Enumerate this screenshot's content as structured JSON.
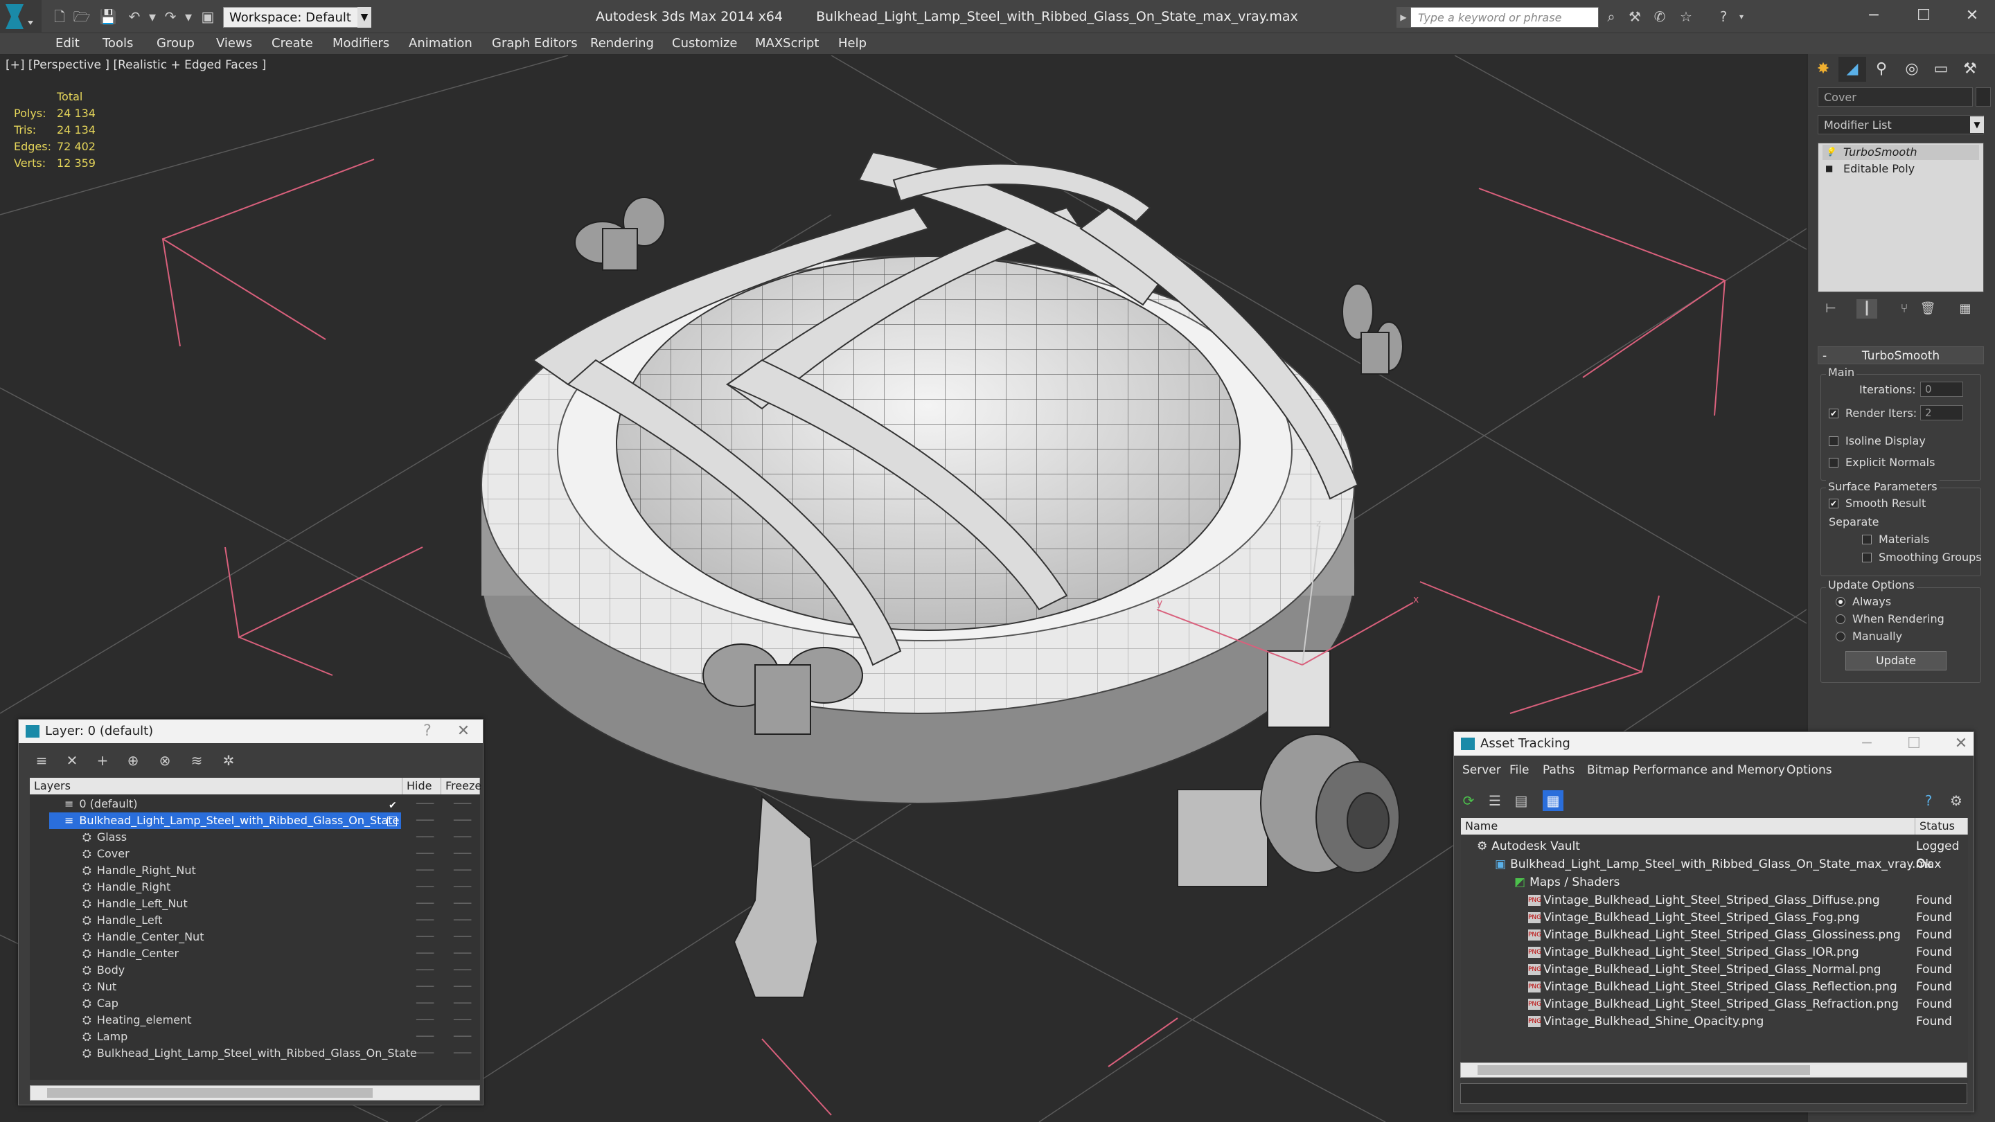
{
  "titlebar": {
    "workspace": "Workspace: Default",
    "app_name": "Autodesk 3ds Max  2014 x64",
    "file_name": "Bulkhead_Light_Lamp_Steel_with_Ribbed_Glass_On_State_max_vray.max",
    "search_placeholder": "Type a keyword or phrase"
  },
  "menu": [
    "Edit",
    "Tools",
    "Group",
    "Views",
    "Create",
    "Modifiers",
    "Animation",
    "Graph Editors",
    "Rendering",
    "Customize",
    "MAXScript",
    "Help"
  ],
  "viewport": {
    "label": "[+] [Perspective ] [Realistic + Edged Faces ]",
    "stats_header": "Total",
    "stats": [
      {
        "k": "Polys:",
        "v": "24 134"
      },
      {
        "k": "Tris:",
        "v": "24 134"
      },
      {
        "k": "Edges:",
        "v": "72 402"
      },
      {
        "k": "Verts:",
        "v": "12 359"
      }
    ],
    "axis": {
      "x": "x",
      "y": "y",
      "z": "z"
    }
  },
  "command_panel": {
    "object_name": "Cover",
    "modifier_list": "Modifier List",
    "stack": [
      "TurboSmooth",
      "Editable Poly"
    ],
    "rollout_title": "TurboSmooth",
    "main_group": "Main",
    "iterations_label": "Iterations:",
    "iterations_value": "0",
    "render_iters_label": "Render Iters:",
    "render_iters_value": "2",
    "isoline": "Isoline Display",
    "explicit_normals": "Explicit Normals",
    "surface_group": "Surface Parameters",
    "smooth_result": "Smooth Result",
    "separate": "Separate",
    "materials": "Materials",
    "smoothing_groups": "Smoothing Groups",
    "update_group": "Update Options",
    "always": "Always",
    "when_rendering": "When Rendering",
    "manually": "Manually",
    "update_button": "Update"
  },
  "layer_dialog": {
    "title": "Layer: 0 (default)",
    "help": "?",
    "col_layers": "Layers",
    "col_hide": "Hide",
    "col_freeze": "Freeze",
    "rows": [
      "0 (default)",
      "Bulkhead_Light_Lamp_Steel_with_Ribbed_Glass_On_State",
      "Glass",
      "Cover",
      "Handle_Right_Nut",
      "Handle_Right",
      "Handle_Left_Nut",
      "Handle_Left",
      "Handle_Center_Nut",
      "Handle_Center",
      "Body",
      "Nut",
      "Cap",
      "Heating_element",
      "Lamp",
      "Bulkhead_Light_Lamp_Steel_with_Ribbed_Glass_On_State"
    ]
  },
  "asset_dialog": {
    "title": "Asset Tracking",
    "menu": [
      "Server",
      "File",
      "Paths",
      "Bitmap Performance and Memory",
      "Options"
    ],
    "col_name": "Name",
    "col_status": "Status",
    "rows": [
      {
        "name": "Autodesk Vault",
        "status": "Logged O"
      },
      {
        "name": "Bulkhead_Light_Lamp_Steel_with_Ribbed_Glass_On_State_max_vray.max",
        "status": "Ok"
      },
      {
        "name": "Maps / Shaders",
        "status": ""
      },
      {
        "name": "Vintage_Bulkhead_Light_Steel_Striped_Glass_Diffuse.png",
        "status": "Found"
      },
      {
        "name": "Vintage_Bulkhead_Light_Steel_Striped_Glass_Fog.png",
        "status": "Found"
      },
      {
        "name": "Vintage_Bulkhead_Light_Steel_Striped_Glass_Glossiness.png",
        "status": "Found"
      },
      {
        "name": "Vintage_Bulkhead_Light_Steel_Striped_Glass_IOR.png",
        "status": "Found"
      },
      {
        "name": "Vintage_Bulkhead_Light_Steel_Striped_Glass_Normal.png",
        "status": "Found"
      },
      {
        "name": "Vintage_Bulkhead_Light_Steel_Striped_Glass_Reflection.png",
        "status": "Found"
      },
      {
        "name": "Vintage_Bulkhead_Light_Steel_Striped_Glass_Refraction.png",
        "status": "Found"
      },
      {
        "name": "Vintage_Bulkhead_Shine_Opacity.png",
        "status": "Found"
      }
    ]
  },
  "colors": {
    "selection": "#2a6edb",
    "stats_text": "#e6d65a",
    "grid_line": "#e05a7a"
  }
}
